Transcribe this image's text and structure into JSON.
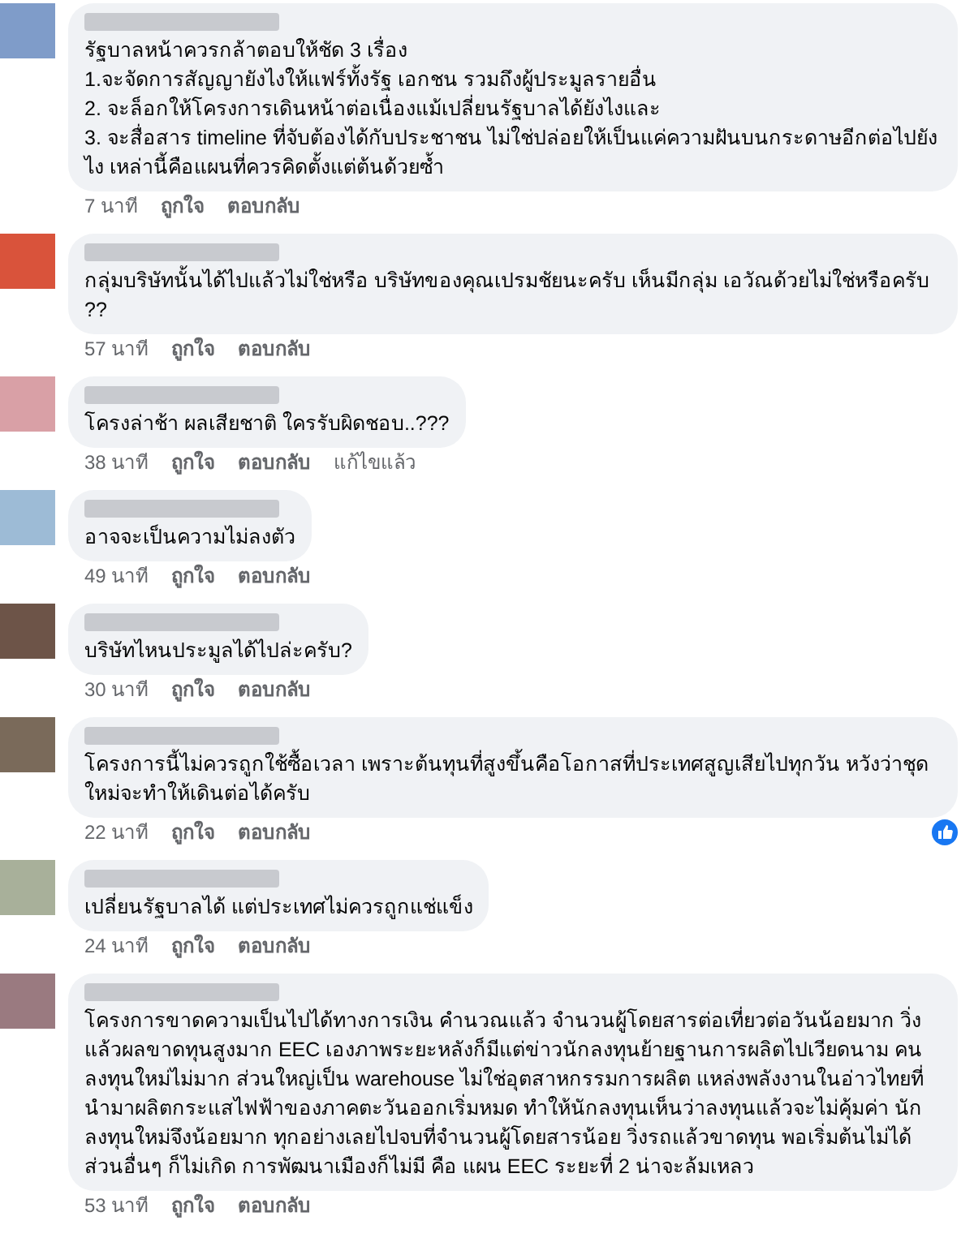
{
  "comments": [
    {
      "color": "#7f9cc9",
      "text": "รัฐบาลหน้าควรกล้าตอบให้ชัด 3 เรื่อง\n1.จะจัดการสัญญายังไงให้แฟร์ทั้งรัฐ เอกชน รวมถึงผู้ประมูลรายอื่น\n2. จะล็อกให้โครงการเดินหน้าต่อเนื่องแม้เปลี่ยนรัฐบาลได้ยังไงและ\n3. จะสื่อสาร timeline ที่จับต้องได้กับประชาชน ไม่ใช่ปล่อยให้เป็นแค่ความฝันบนกระดาษอีกต่อไปยังไง เหล่านี้คือแผนที่ควรคิดตั้งแต่ต้นด้วยซ้ำ",
      "time": "7 นาที",
      "like": "ถูกใจ",
      "reply": "ตอบกลับ"
    },
    {
      "color": "#d9533b",
      "text": "กลุ่มบริษัทนั้นได้ไปแล้วไม่ใช่หรือ บริษัทของคุณเปรมชัยนะครับ เห็นมีกลุ่ม เอวัณด้วยไม่ใช่หรือครับ ??",
      "time": "57 นาที",
      "like": "ถูกใจ",
      "reply": "ตอบกลับ"
    },
    {
      "color": "#d9a0a6",
      "text": "โครงล่าช้า ผลเสียชาติ ใครรับผิดชอบ..???",
      "time": "38 นาที",
      "like": "ถูกใจ",
      "reply": "ตอบกลับ",
      "edited": "แก้ไขแล้ว"
    },
    {
      "color": "#9dbbd6",
      "text": "อาจจะเป็นความไม่ลงตัว",
      "time": "49 นาที",
      "like": "ถูกใจ",
      "reply": "ตอบกลับ"
    },
    {
      "color": "#6d5448",
      "text": "บริษัทไหนประมูลได้ไปล่ะครับ?",
      "time": "30 นาที",
      "like": "ถูกใจ",
      "reply": "ตอบกลับ"
    },
    {
      "color": "#7a6a5a",
      "text": "โครงการนี้ไม่ควรถูกใช้ซื้อเวลา เพราะต้นทุนที่สูงขึ้นคือโอกาสที่ประเทศสูญเสียไปทุกวัน หวังว่าชุดใหม่จะทำให้เดินต่อได้ครับ",
      "time": "22 นาที",
      "like": "ถูกใจ",
      "reply": "ตอบกลับ",
      "reaction": {
        "kind": "like"
      }
    },
    {
      "color": "#a8b09a",
      "text": "เปลี่ยนรัฐบาลได้ แต่ประเทศไม่ควรถูกแช่แข็ง",
      "time": "24 นาที",
      "like": "ถูกใจ",
      "reply": "ตอบกลับ"
    },
    {
      "color": "#9a7a80",
      "text": "โครงการขาดความเป็นไปได้ทางการเงิน คำนวณแล้ว จำนวนผู้โดยสารต่อเที่ยวต่อวันน้อยมาก วิ่งแล้วผลขาดทุนสูงมาก EEC เองภาพระยะหลังก็มีแต่ข่าวนักลงทุนย้ายฐานการผลิตไปเวียดนาม คนลงทุนใหม่ไม่มาก ส่วนใหญ่เป็น warehouse ไม่ใช่อุตสาหกรรมการผลิต แหล่งพลังงานในอ่าวไทยที่นำมาผลิตกระแสไฟฟ้าของภาคตะวันออกเริ่มหมด ทำให้นักลงทุนเห็นว่าลงทุนแล้วจะไม่คุ้มค่า นักลงทุนใหม่จึงน้อยมาก ทุกอย่างเลยไปจบที่จำนวนผู้โดยสารน้อย วิ่งรถแล้วขาดทุน พอเริ่มต้นไม่ได้ ส่วนอื่นๆ ก็ไม่เกิด การพัฒนาเมืองก็ไม่มี คือ แผน EEC ระยะที่ 2 น่าจะล้มเหลว",
      "time": "53 นาที",
      "like": "ถูกใจ",
      "reply": "ตอบกลับ"
    }
  ]
}
